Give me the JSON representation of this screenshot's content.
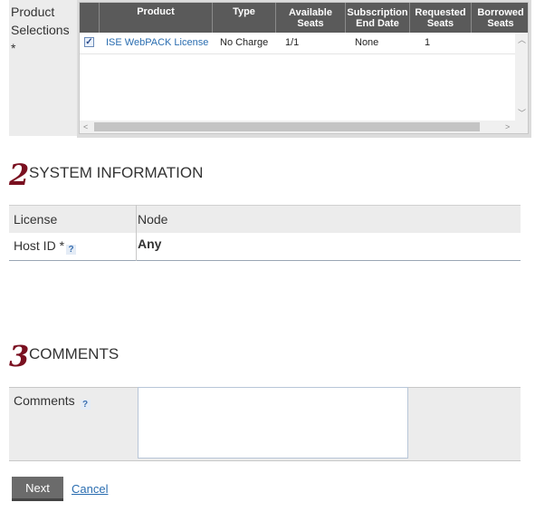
{
  "product_selections": {
    "label": "Product Selections",
    "required_marker": "*",
    "columns": [
      "Product",
      "Type",
      "Available Seats",
      "Subscription End Date",
      "Requested Seats",
      "Borrowed Seats"
    ],
    "rows": [
      {
        "checked": true,
        "product": "ISE WebPACK License",
        "type": "No Charge",
        "available_seats": "1/1",
        "subscription_end_date": "None",
        "requested_seats": "1",
        "borrowed_seats": ""
      }
    ]
  },
  "system_information": {
    "number": "2",
    "title": "SYSTEM INFORMATION",
    "license_label": "License",
    "license_value": "Node",
    "host_id_label": "Host ID *",
    "host_id_help": "?",
    "host_id_value": "Any"
  },
  "comments": {
    "number": "3",
    "title": "COMMENTS",
    "label": "Comments",
    "help": "?",
    "value": ""
  },
  "actions": {
    "next_label": "Next",
    "cancel_label": "Cancel"
  },
  "colors": {
    "section_number": "#7a1020",
    "header_bg": "#5a5a5a",
    "link": "#2a6db0",
    "button_bg": "#6b6b6b"
  }
}
